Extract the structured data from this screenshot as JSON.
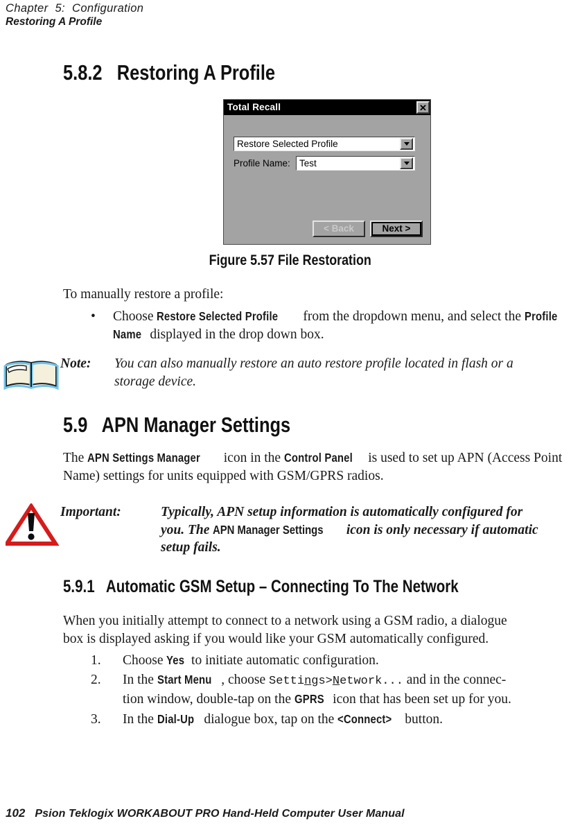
{
  "runhead": {
    "chapter": "Chapter  5:  Configuration",
    "section": "Restoring A Profile"
  },
  "headings": {
    "h582": "5.8.2   Restoring A Profile",
    "h59": "5.9   APN Manager Settings",
    "h591": "5.9.1   Automatic GSM Setup – Connecting To The Network"
  },
  "dialog": {
    "title": "Total Recall",
    "close_icon": "close-x-icon",
    "mode_value": "Restore Selected Profile",
    "profile_label": "Profile Name:",
    "profile_value": "Test",
    "back_button": "< Back",
    "next_button": "Next >",
    "dropdown_icon": "chevron-down-icon",
    "colors": {
      "titlebar": "#000000",
      "face": "#a3a3a3",
      "field": "#ffffff",
      "disabled_text": "#c9c9c9"
    }
  },
  "figure_caption": "Figure  5.57  File Restoration",
  "intro": {
    "lead": "To manually restore a profile:",
    "bullet_marker": "•",
    "bullet_part1": "Choose ",
    "bullet_ui1": "Restore  Selected  Profile",
    "bullet_part2": " from the dropdown menu, and select the ",
    "bullet_ui2": "Profile",
    "bullet_ui3": "Name",
    "bullet_part3": " displayed in the drop down box."
  },
  "note": {
    "icon": "open-book-icon",
    "label": "Note:",
    "line1": "You can also manually restore an auto restore profile located in flash or a",
    "line2": "storage device."
  },
  "apn_paragraph": {
    "part1": "The ",
    "ui1": "APN  Settings  Manager",
    "part2": " icon in the ",
    "ui2": "Control  Panel",
    "part3": " is used to set up APN (Access Point",
    "line2": "Name) settings for units equipped with GSM/GPRS radios."
  },
  "important": {
    "icon": "warning-triangle-icon",
    "label": "Important:",
    "line1": "Typically, APN setup information is automatically configured for",
    "line2_part1": "you. The ",
    "line2_ui": "APN  Manager  Settings",
    "line2_part2": " icon is only necessary if automatic",
    "line3": "setup fails.",
    "icon_color": "#d61b1b"
  },
  "gsm": {
    "para_line1": "When you initially attempt to connect to a network using a GSM radio, a dialogue",
    "para_line2": "box is displayed asking if you would like your GSM automatically configured.",
    "steps": [
      {
        "marker": "1.",
        "part1": "Choose ",
        "ui1": "Yes",
        "part2": " to initiate automatic configuration."
      },
      {
        "marker": "2.",
        "part1": "In the ",
        "ui1": "Start  Menu",
        "part2": ", choose ",
        "mono_a": "Setti",
        "mono_a_u": "n",
        "mono_b": "gs>",
        "mono_b_u": "N",
        "mono_c": "etwork...",
        "part3": " and in the connec-",
        "line2_part1": "tion window, double-tap on the ",
        "line2_ui": "GPRS",
        "line2_part2": " icon that has been set up for you."
      },
      {
        "marker": "3.",
        "part1": "In the ",
        "ui1": "Dial-Up",
        "part2": " dialogue box, tap on the ",
        "ui2": "<Connect>",
        "part3": " button."
      }
    ]
  },
  "footer": {
    "page_number": "102",
    "text": "Psion Teklogix WORKABOUT PRO Hand-Held Computer User Manual"
  }
}
